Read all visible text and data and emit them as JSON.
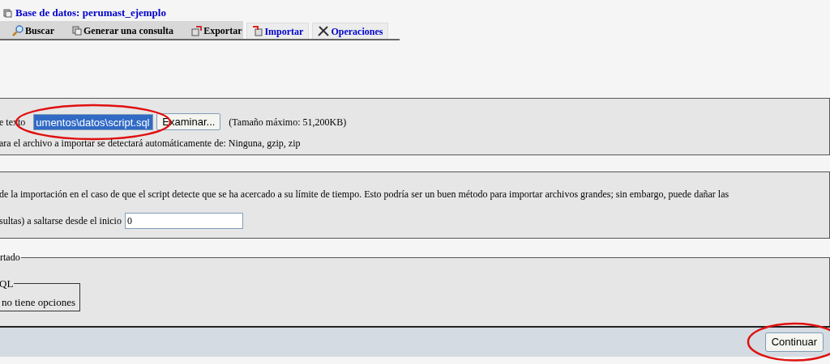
{
  "title": "Base de datos: perumast_ejemplo",
  "tabs": [
    {
      "label": "Buscar",
      "selected": false
    },
    {
      "label": "Generar una consulta",
      "selected": false
    },
    {
      "label": "Exportar",
      "selected": false
    },
    {
      "label": "Importar",
      "selected": true
    },
    {
      "label": "Operaciones",
      "selected": true
    }
  ],
  "file_section": {
    "label": "e texto",
    "file_value": "umentos\\datos\\script.sql",
    "file_circled": true,
    "browse_button": "Examinar...",
    "max_size": "(Tamaño máximo: 51,200KB)",
    "compression_note": "ara el archivo a importar se detectará automáticamente de: Ninguna, gzip, zip"
  },
  "partial_section": {
    "note": "de la importación en el caso de que el script detecte que se ha acercado a su límite de tiempo. Esto podría ser un buen método para importar archivos grandes; sin embargo, puede dañar las",
    "skip_label": "sultas) a saltarse desde el inicio",
    "skip_value": "0"
  },
  "format_section": {
    "legend": "rtado",
    "inner_legend": "QL",
    "inner_text": "no tiene opciones"
  },
  "footer": {
    "button": "Continuar",
    "circled": true
  }
}
